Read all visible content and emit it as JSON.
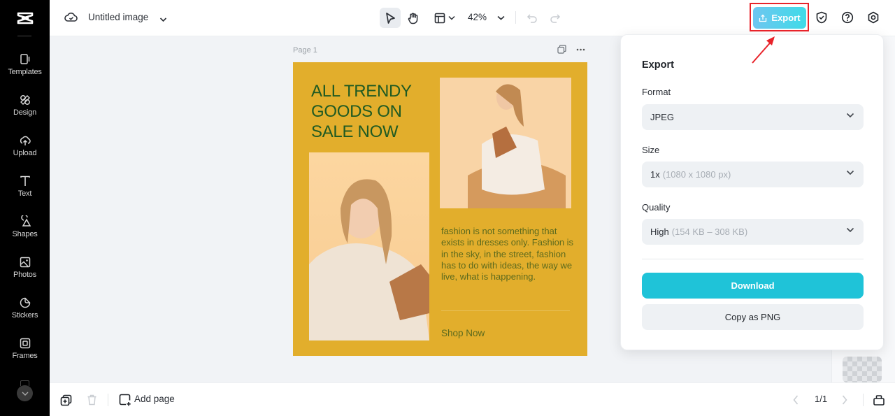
{
  "app": {
    "logo": "capcut-logo"
  },
  "sidebar": {
    "items": [
      {
        "label": "Templates",
        "icon": "templates-icon"
      },
      {
        "label": "Design",
        "icon": "design-icon"
      },
      {
        "label": "Upload",
        "icon": "upload-icon"
      },
      {
        "label": "Text",
        "icon": "text-icon"
      },
      {
        "label": "Shapes",
        "icon": "shapes-icon"
      },
      {
        "label": "Photos",
        "icon": "photos-icon"
      },
      {
        "label": "Stickers",
        "icon": "stickers-icon"
      },
      {
        "label": "Frames",
        "icon": "frames-icon"
      }
    ]
  },
  "header": {
    "title": "Untitled image",
    "zoom": "42%",
    "export_label": "Export"
  },
  "canvas": {
    "page_label": "Page 1",
    "poster": {
      "headline": [
        "ALL TRENDY",
        "GOODS ON",
        "SALE NOW"
      ],
      "body": "fashion is not something that exists in dresses only. Fashion is in the sky, in the street, fashion has to do with ideas, the way we live, what is happening.",
      "cta": "Shop Now",
      "colors": {
        "background": "#e2ae2c",
        "headline": "#1f5a22"
      }
    }
  },
  "export_panel": {
    "title": "Export",
    "format": {
      "label": "Format",
      "value": "JPEG"
    },
    "size": {
      "label": "Size",
      "value": "1x",
      "detail": "(1080 x 1080 px)"
    },
    "quality": {
      "label": "Quality",
      "value": "High",
      "detail": "(154 KB – 308 KB)"
    },
    "download_label": "Download",
    "copy_label": "Copy as PNG",
    "accent": "#1fc3d8"
  },
  "footer": {
    "add_page_label": "Add page",
    "pager": "1/1"
  }
}
